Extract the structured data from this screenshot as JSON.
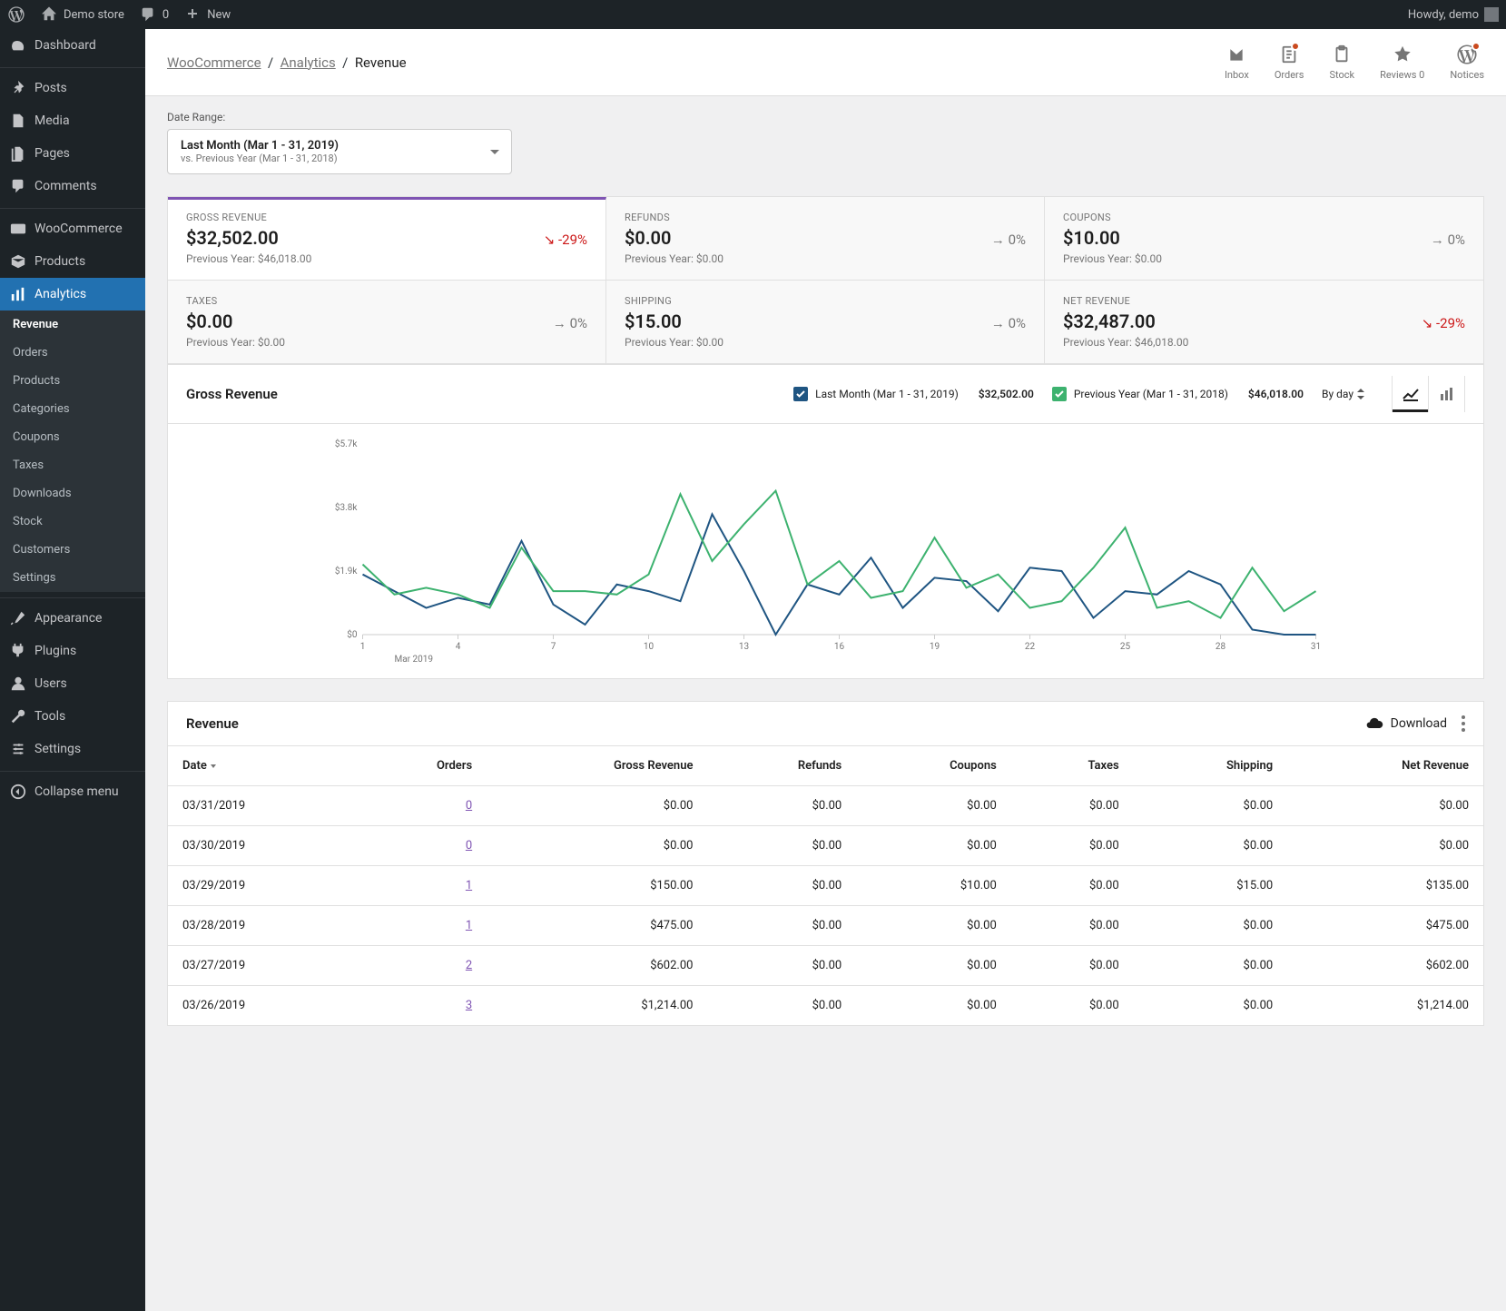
{
  "adminbar": {
    "site_name": "Demo store",
    "comments_count": "0",
    "new_label": "New",
    "howdy": "Howdy, demo"
  },
  "sidebar": {
    "items": [
      {
        "label": "Dashboard",
        "icon": "gauge"
      },
      {
        "label": "Posts",
        "icon": "pin"
      },
      {
        "label": "Media",
        "icon": "media"
      },
      {
        "label": "Pages",
        "icon": "pages"
      },
      {
        "label": "Comments",
        "icon": "comment"
      },
      {
        "label": "WooCommerce",
        "icon": "woo"
      },
      {
        "label": "Products",
        "icon": "products"
      },
      {
        "label": "Analytics",
        "icon": "analytics",
        "current": true
      },
      {
        "label": "Appearance",
        "icon": "brush"
      },
      {
        "label": "Plugins",
        "icon": "plug"
      },
      {
        "label": "Users",
        "icon": "user"
      },
      {
        "label": "Tools",
        "icon": "wrench"
      },
      {
        "label": "Settings",
        "icon": "settings"
      },
      {
        "label": "Collapse menu",
        "icon": "collapse"
      }
    ],
    "analytics_sub": [
      "Revenue",
      "Orders",
      "Products",
      "Categories",
      "Coupons",
      "Taxes",
      "Downloads",
      "Stock",
      "Customers",
      "Settings"
    ]
  },
  "breadcrumb": {
    "root": "WooCommerce",
    "mid": "Analytics",
    "leaf": "Revenue"
  },
  "activity": {
    "inbox": "Inbox",
    "orders": "Orders",
    "stock": "Stock",
    "reviews": "Reviews 0",
    "notices": "Notices"
  },
  "date_range": {
    "label": "Date Range:",
    "primary": "Last Month (Mar 1 - 31, 2019)",
    "secondary": "vs. Previous Year (Mar 1 - 31, 2018)"
  },
  "summary": [
    {
      "label": "Gross Revenue",
      "value": "$32,502.00",
      "delta": "-29%",
      "dir": "down-neg",
      "prev": "Previous Year: $46,018.00",
      "selected": true
    },
    {
      "label": "Refunds",
      "value": "$0.00",
      "delta": "0%",
      "dir": "flat",
      "prev": "Previous Year: $0.00"
    },
    {
      "label": "Coupons",
      "value": "$10.00",
      "delta": "0%",
      "dir": "flat",
      "prev": "Previous Year: $0.00"
    },
    {
      "label": "Taxes",
      "value": "$0.00",
      "delta": "0%",
      "dir": "flat",
      "prev": "Previous Year: $0.00"
    },
    {
      "label": "Shipping",
      "value": "$15.00",
      "delta": "0%",
      "dir": "flat",
      "prev": "Previous Year: $0.00"
    },
    {
      "label": "Net Revenue",
      "value": "$32,487.00",
      "delta": "-29%",
      "dir": "down-neg",
      "prev": "Previous Year: $46,018.00"
    }
  ],
  "chart": {
    "title": "Gross Revenue",
    "legend": [
      {
        "label": "Last Month (Mar 1 - 31, 2019)",
        "value": "$32,502.00",
        "color": "#1f5582"
      },
      {
        "label": "Previous Year (Mar 1 - 31, 2018)",
        "value": "$46,018.00",
        "color": "#3db26f"
      }
    ],
    "interval": "By day"
  },
  "chart_data": {
    "type": "line",
    "xlabel": "Mar 2019",
    "ylabel": "",
    "ylim": [
      0,
      5700
    ],
    "yticks": [
      "$0",
      "$1.9k",
      "$3.8k",
      "$5.7k"
    ],
    "xticks": [
      1,
      4,
      7,
      10,
      13,
      16,
      19,
      22,
      25,
      28,
      31
    ],
    "x": [
      1,
      2,
      3,
      4,
      5,
      6,
      7,
      8,
      9,
      10,
      11,
      12,
      13,
      14,
      15,
      16,
      17,
      18,
      19,
      20,
      21,
      22,
      23,
      24,
      25,
      26,
      27,
      28,
      29,
      30,
      31
    ],
    "series": [
      {
        "name": "Last Month (Mar 1 - 31, 2019)",
        "color": "#1f5582",
        "values": [
          1800,
          1300,
          800,
          1100,
          900,
          2800,
          900,
          300,
          1500,
          1300,
          1000,
          3600,
          1900,
          0,
          1500,
          1200,
          2300,
          800,
          1700,
          1600,
          700,
          2000,
          1900,
          500,
          1300,
          1200,
          1900,
          1500,
          150,
          0,
          0
        ]
      },
      {
        "name": "Previous Year (Mar 1 - 31, 2018)",
        "color": "#3db26f",
        "values": [
          2100,
          1200,
          1400,
          1200,
          800,
          2600,
          1300,
          1300,
          1200,
          1800,
          4200,
          2200,
          3300,
          4300,
          1500,
          2200,
          1100,
          1300,
          2900,
          1400,
          1800,
          800,
          1000,
          2000,
          3200,
          800,
          1000,
          500,
          2000,
          700,
          1300
        ]
      }
    ]
  },
  "table": {
    "title": "Revenue",
    "download_label": "Download",
    "columns": [
      "Date",
      "Orders",
      "Gross Revenue",
      "Refunds",
      "Coupons",
      "Taxes",
      "Shipping",
      "Net Revenue"
    ],
    "rows": [
      {
        "date": "03/31/2019",
        "orders": "0",
        "gross": "$0.00",
        "refunds": "$0.00",
        "coupons": "$0.00",
        "taxes": "$0.00",
        "shipping": "$0.00",
        "net": "$0.00"
      },
      {
        "date": "03/30/2019",
        "orders": "0",
        "gross": "$0.00",
        "refunds": "$0.00",
        "coupons": "$0.00",
        "taxes": "$0.00",
        "shipping": "$0.00",
        "net": "$0.00"
      },
      {
        "date": "03/29/2019",
        "orders": "1",
        "gross": "$150.00",
        "refunds": "$0.00",
        "coupons": "$10.00",
        "taxes": "$0.00",
        "shipping": "$15.00",
        "net": "$135.00"
      },
      {
        "date": "03/28/2019",
        "orders": "1",
        "gross": "$475.00",
        "refunds": "$0.00",
        "coupons": "$0.00",
        "taxes": "$0.00",
        "shipping": "$0.00",
        "net": "$475.00"
      },
      {
        "date": "03/27/2019",
        "orders": "2",
        "gross": "$602.00",
        "refunds": "$0.00",
        "coupons": "$0.00",
        "taxes": "$0.00",
        "shipping": "$0.00",
        "net": "$602.00"
      },
      {
        "date": "03/26/2019",
        "orders": "3",
        "gross": "$1,214.00",
        "refunds": "$0.00",
        "coupons": "$0.00",
        "taxes": "$0.00",
        "shipping": "$0.00",
        "net": "$1,214.00"
      }
    ]
  }
}
